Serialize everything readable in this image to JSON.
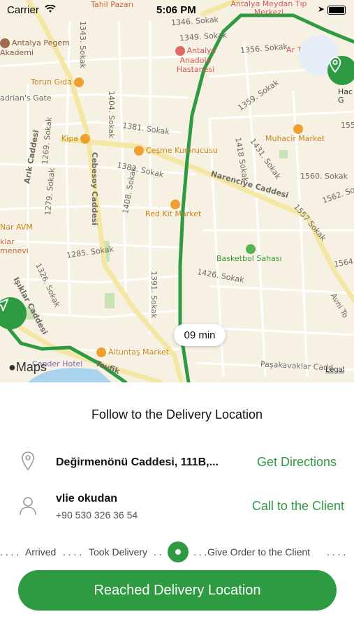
{
  "status_bar": {
    "carrier": "Carrier",
    "time": "5:06 PM"
  },
  "map": {
    "street_labels": [
      "1346. Sokak",
      "1349. Sokak",
      "1356. Sokak",
      "1343. Sokak",
      "1359. Sokak",
      "1404. Sokak",
      "1381. Sokak",
      "1383. Sokak",
      "1418 Sokak",
      "1431. Sokak",
      "1560. Sokak",
      "1562. Sokak",
      "1557 Sokak",
      "1408. Sokak",
      "1285. Sokak",
      "1426. Sokak",
      "1391. Sokak",
      "1564.",
      "1279. Sokak",
      "1269. Sokak",
      "1326. Sokak",
      "Cebesoy Caddesi",
      "Narenciye Caddesi",
      "Arık Caddesi",
      "Işıklar Caddesi",
      "Avni To",
      "Paşakavaklar Cadd",
      "Tevfik",
      "adrian's Gate",
      "155"
    ],
    "pois": [
      {
        "name": "Tahil Pazarı",
        "color": "#e07a4f"
      },
      {
        "name": "Antalya Meydan Tıp Merkezi",
        "color": "#e06a6a"
      },
      {
        "name": "Antalya Pegem Akademi",
        "color": "#a06a50"
      },
      {
        "name": "Antalya Anadolu Hastanesi",
        "color": "#e06a6a"
      },
      {
        "name": "Torun Gıda",
        "color": "#f0a030"
      },
      {
        "name": "Kipa",
        "color": "#f0a030"
      },
      {
        "name": "Çeşme Kumrucusu",
        "color": "#f0a030"
      },
      {
        "name": "Muhacir Market",
        "color": "#f0a030"
      },
      {
        "name": "Red Kit Market",
        "color": "#f0a030"
      },
      {
        "name": "Nar AVM",
        "color": "#f0a030"
      },
      {
        "name": "Basketbol Sahası",
        "color": "#55b350"
      },
      {
        "name": "Altuntaş Market",
        "color": "#f0a030"
      },
      {
        "name": "Cender Hotel",
        "color": "#9a7cd0"
      },
      {
        "name": "klar menevi",
        "color": "#e07a4f"
      },
      {
        "name": "Ar Tı",
        "color": "#e06a6a"
      },
      {
        "name": "Hac G",
        "color": "#333333"
      }
    ],
    "eta": "09 min",
    "attribution": "Maps",
    "legal": "Legal"
  },
  "sheet": {
    "title": "Follow to the Delivery Location",
    "address": "Değirmenönü Caddesi, 111B,...",
    "get_directions": "Get Directions",
    "client_name": "vlie okudan",
    "client_phone": "+90 530 326 36 54",
    "call_client": "Call to the Client",
    "steps": {
      "lead_dots": ". . . .",
      "arrived": "Arrived",
      "gap1": ". . . .",
      "took_delivery": "Took Delivery",
      "gap2": ". .",
      "gap3": ". . .",
      "give_order": "Give Order to the Client",
      "trail_dots": ". . . ."
    },
    "action_button": "Reached Delivery Location"
  },
  "colors": {
    "accent": "#2e9b43",
    "route": "#2e9b43",
    "map_bg": "#f6f1e3"
  },
  "icons": [
    "wifi-icon",
    "location-arrow-icon",
    "battery-icon",
    "navigate-icon",
    "map-pin-icon",
    "person-icon",
    "apple-logo-icon"
  ]
}
